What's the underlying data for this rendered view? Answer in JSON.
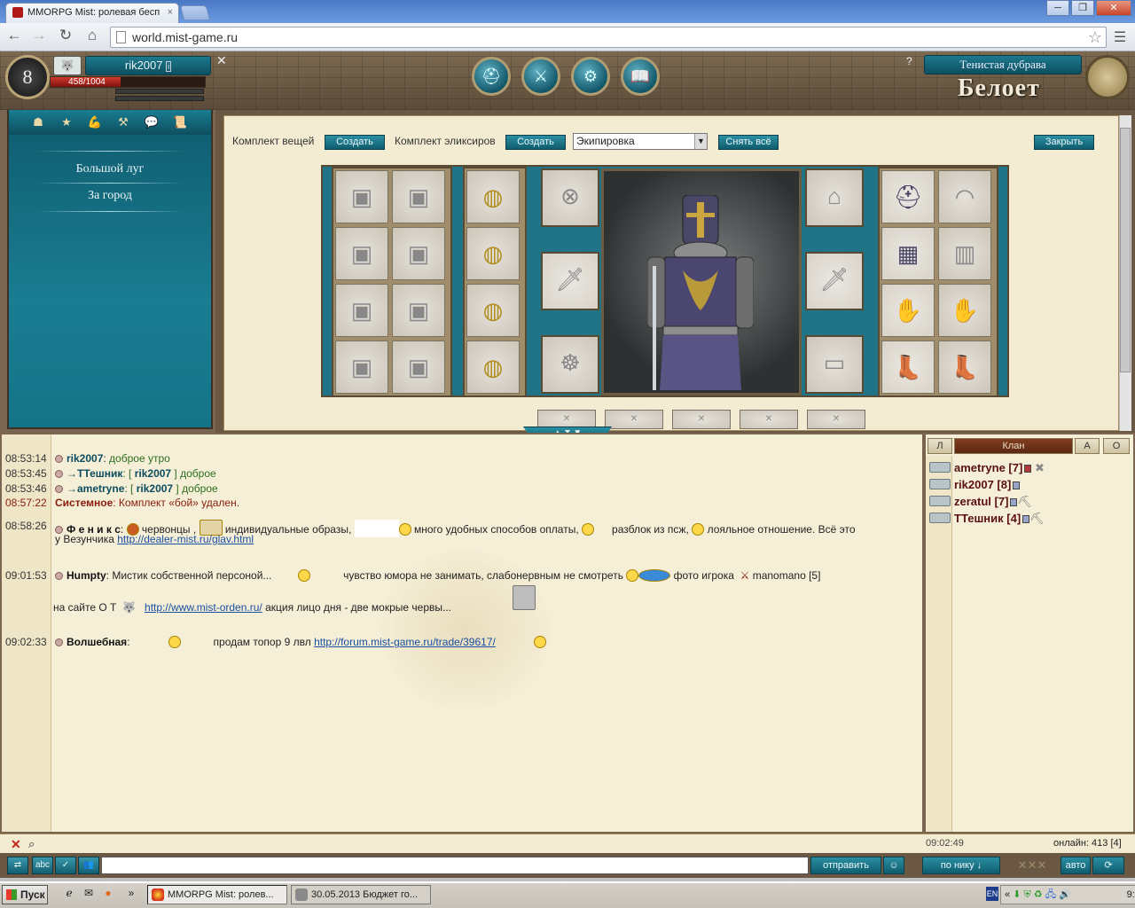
{
  "browser": {
    "tab_title": "MMORPG Mist: ролевая бесп",
    "tab_close": "×",
    "url": "world.mist-game.ru",
    "window_buttons": [
      "─",
      "❐",
      "✕"
    ]
  },
  "header": {
    "level": "8",
    "nick": "rik2007",
    "hp": "458/1004",
    "hp_fraction": 0.456,
    "location": "Тенистая дубрава",
    "logo": "Белоет",
    "help": "?"
  },
  "left_panel": {
    "links": [
      "Большой луг",
      "За город"
    ]
  },
  "equip_toolbar": {
    "items_set_label": "Комплект вещей",
    "create_label": "Создать",
    "elixir_set_label": "Комплект эликсиров",
    "create2_label": "Создать",
    "select_value": "Экипировка",
    "remove_all_label": "Снять всё",
    "close_label": "Закрыть"
  },
  "chat": {
    "lines": [
      {
        "time": "08:53:14",
        "nick": "rik2007",
        "text": "доброе утро"
      },
      {
        "time": "08:53:45",
        "nick": "→ТТешник",
        "to": "rik2007",
        "text": "доброе"
      },
      {
        "time": "08:53:46",
        "nick": "→ametryne",
        "to": "rik2007",
        "text": "доброе"
      },
      {
        "time": "08:57:22",
        "nick": "Системное",
        "text": "Комплект «бой» удален."
      },
      {
        "time": "08:58:26",
        "nick": "Ф е н и к с",
        "text": "червонцы ,",
        "text2": "индивидуальные образы,",
        "text3": "много удобных способов оплаты,",
        "text4": "разблок из псж,",
        "text5": "лояльное отношение. Всё это",
        "text6": "у Везунчика",
        "link": "http://dealer-mist.ru/glav.html"
      },
      {
        "time": "09:01:53",
        "nick": "Humpty",
        "text": "Мистик собственной персоной...",
        "text2": "чувство юмора не занимать, слабонервным не смотреть",
        "text3": "фото игрока",
        "text4": "manomano [5]",
        "text5": "на сайте О Т",
        "link": "http://www.mist-orden.ru/",
        "text6": "акция лицо дня - две мокрые червы..."
      },
      {
        "time": "09:02:33",
        "nick": "Волшебная",
        "text": "продам топор 9 лвл",
        "link": "http://forum.mist-game.ru/trade/39617/"
      }
    ]
  },
  "clan_panel": {
    "tab_left": "Л",
    "tab_clan": "Клан",
    "tab_a": "А",
    "tab_o": "О",
    "players": [
      "ametryne [7]",
      "rik2007 [8]",
      "zeratul [7]",
      "ТТешник [4]"
    ]
  },
  "status": {
    "time": "09:02:49",
    "online": "онлайн: 413 [4]"
  },
  "input_bar": {
    "send_label": "отправить",
    "by_nick_label": "по нику ↓",
    "auto_label": "авто"
  },
  "taskbar": {
    "start_label": "Пуск",
    "task1": "MMORPG Mist: ролев...",
    "task2": "30.05.2013 Бюджет го...",
    "lang": "EN",
    "clock": "9:03"
  },
  "colors": {
    "teal": "#1a7d92",
    "parchment": "#f4ecd2",
    "wood": "#6a5844"
  }
}
